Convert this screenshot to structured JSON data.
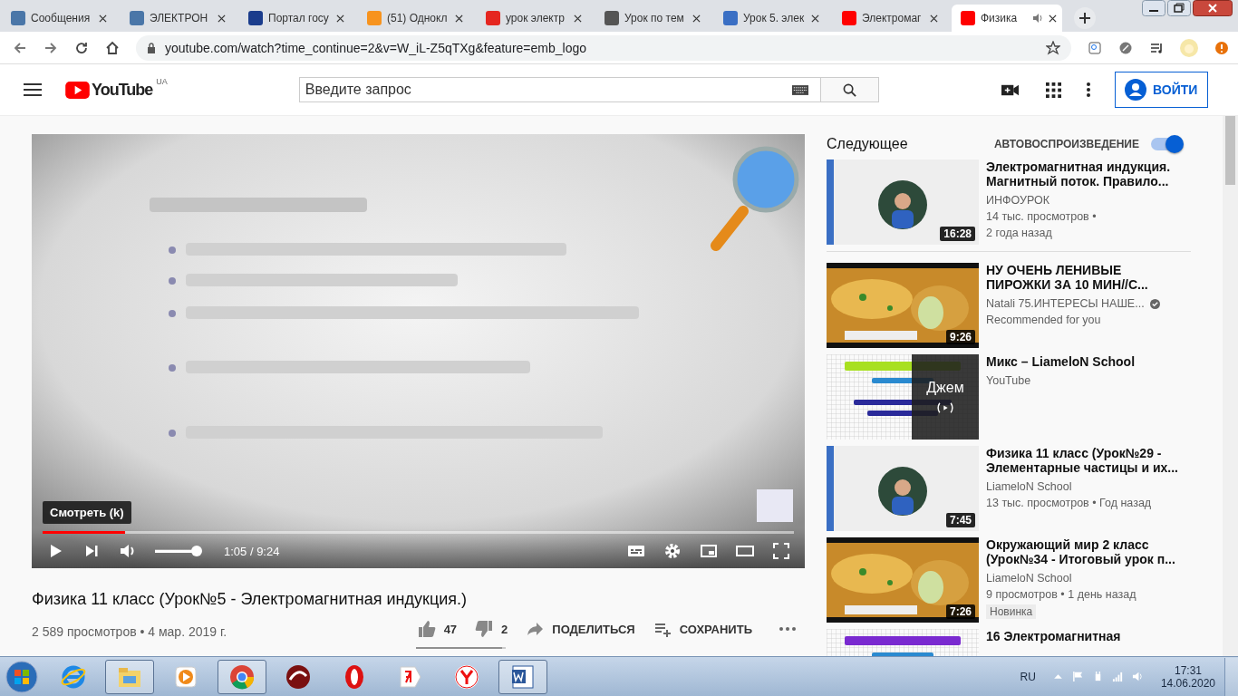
{
  "browser": {
    "tabs": [
      {
        "title": "Сообщения",
        "color": "#4a76a8",
        "selected": false
      },
      {
        "title": "ЭЛЕКТРОН",
        "color": "#4a76a8",
        "selected": false
      },
      {
        "title": "Портал госу",
        "color": "#1a3c8c",
        "selected": false
      },
      {
        "title": "(51) Однокл",
        "color": "#f7931e",
        "selected": false
      },
      {
        "title": "урок электр",
        "color": "#e52620",
        "selected": false
      },
      {
        "title": "Урок по тем",
        "color": "#555555",
        "selected": false
      },
      {
        "title": "Урок 5. элек",
        "color": "#3a6fc4",
        "selected": false
      },
      {
        "title": "Электромаг",
        "color": "#ff0000",
        "selected": false
      },
      {
        "title": "Физика",
        "color": "#ff0000",
        "selected": true,
        "audio": true
      }
    ],
    "url": "youtube.com/watch?time_continue=2&v=W_iL-Z5qTXg&feature=emb_logo"
  },
  "youtube": {
    "logo": "YouTube",
    "region": "UA",
    "search_placeholder": "Введите запрос",
    "sign_in": "ВОЙТИ"
  },
  "player": {
    "tooltip": "Смотреть (k)",
    "progress": {
      "level": 0.11
    },
    "volume": {
      "level": 1
    },
    "time": "1:05 / 9:24"
  },
  "video": {
    "title": "Физика 11 класс (Урок№5 - Электромагнитная индукция.)",
    "stats": "2 589 просмотров • 4 мар. 2019 г.",
    "likes": "47",
    "dislikes": "2",
    "share": "ПОДЕЛИТЬСЯ",
    "save": "СОХРАНИТЬ",
    "rating": {
      "level": 0.96
    }
  },
  "sidebar": {
    "heading": "Следующее",
    "autoplay_label": "АВТОВОСПРОИЗВЕДЕНИЕ",
    "autoplay_on": true,
    "items": [
      {
        "kind": "video",
        "title": "Электромагнитная индукция. Магнитный поток. Правило...",
        "channel": "ИНФОУРОК",
        "meta": [
          "14 тыс. просмотров •",
          "2 года назад"
        ],
        "duration": "16:28"
      },
      {
        "kind": "video",
        "title": "НУ ОЧЕНЬ ЛЕНИВЫЕ ПИРОЖКИ ЗА 10 МИН//С...",
        "channel": "Natali 75.ИНТЕРЕСЫ НАШЕ...",
        "verified": true,
        "meta": [
          "Recommended for you"
        ],
        "duration": "9:26"
      },
      {
        "kind": "mix",
        "title": "Микс – LiameloN School",
        "channel": "YouTube",
        "overlay": "Джем"
      },
      {
        "kind": "video",
        "title": "Физика 11 класс (Урок№29 - Элементарные частицы и их...",
        "channel": "LiameloN School",
        "meta": [
          "13 тыс. просмотров • Год назад"
        ],
        "duration": "7:45"
      },
      {
        "kind": "video",
        "title": "Окружающий мир 2 класс (Урок№34 - Итоговый урок п...",
        "channel": "LiameloN School",
        "meta": [
          "9 просмотров • 1 день назад"
        ],
        "duration": "7:26",
        "badge": "Новинка"
      },
      {
        "kind": "video",
        "title": "16 Электромагнитная"
      }
    ]
  },
  "taskbar": {
    "apps": [
      {
        "kind": "ie",
        "open": false
      },
      {
        "kind": "folder",
        "open": true
      },
      {
        "kind": "media",
        "open": false
      },
      {
        "kind": "chrome",
        "open": true
      },
      {
        "kind": "swirl",
        "open": false
      },
      {
        "kind": "opera",
        "open": false
      },
      {
        "kind": "yabrowser",
        "open": false
      },
      {
        "kind": "yandex",
        "open": false
      },
      {
        "kind": "word",
        "open": true
      }
    ],
    "language": "RU",
    "time": "17:31",
    "date": "14.06.2020"
  }
}
